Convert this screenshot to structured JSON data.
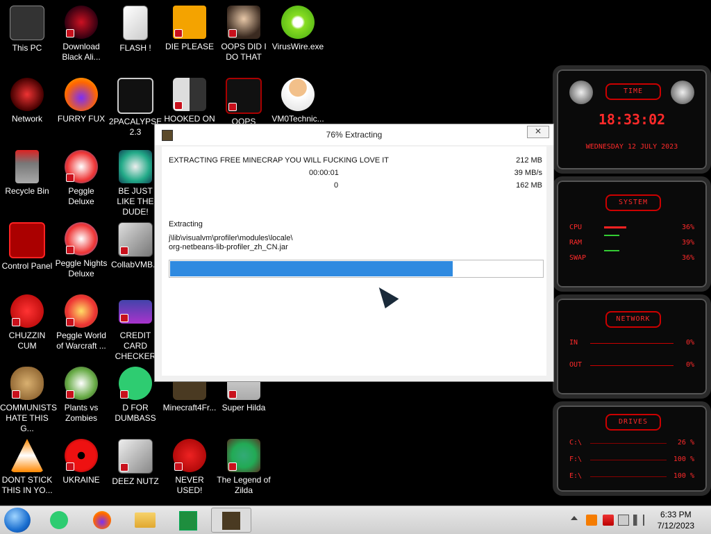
{
  "desktop_icons": [
    {
      "label": "This PC"
    },
    {
      "label": "Download Black Ali..."
    },
    {
      "label": "FLASH !"
    },
    {
      "label": "DIE PLEASE"
    },
    {
      "label": "OOPS DID I DO THAT"
    },
    {
      "label": "VirusWire.exe"
    },
    {
      "label": "Network"
    },
    {
      "label": "FURRY FUX"
    },
    {
      "label": "2PACALYPSE 2.3"
    },
    {
      "label": "HOOKED ON"
    },
    {
      "label": "OOPS"
    },
    {
      "label": "VM0Technic..."
    },
    {
      "label": "Recycle Bin"
    },
    {
      "label": "Peggle Deluxe"
    },
    {
      "label": "BE JUST LIKE THE DUDE!"
    },
    {
      "label": "Control Panel"
    },
    {
      "label": "Peggle Nights Deluxe"
    },
    {
      "label": "CollabVMB..."
    },
    {
      "label": "CHUZZIN CUM"
    },
    {
      "label": "Peggle World of Warcraft ..."
    },
    {
      "label": "CREDIT CARD CHECKER"
    },
    {
      "label": "COMMUNISTS HATE THIS G..."
    },
    {
      "label": "Plants vs Zombies"
    },
    {
      "label": "D FOR DUMBASS"
    },
    {
      "label": "Minecraft4Fr..."
    },
    {
      "label": "Super Hilda"
    },
    {
      "label": "DONT STICK THIS IN YO..."
    },
    {
      "label": "UKRAINE"
    },
    {
      "label": "DEEZ NUTZ"
    },
    {
      "label": "NEVER USED!"
    },
    {
      "label": "The Legend of Zilda"
    }
  ],
  "dialog": {
    "title": "76% Extracting",
    "close_label": "✕",
    "heading": "EXTRACTING FREE MINECRAP YOU WILL FUCKING LOVE IT",
    "size_total": "212 MB",
    "elapsed": "00:00:01",
    "speed": "39 MB/s",
    "remaining": "0",
    "size_processed": "162 MB",
    "status_label": "Extracting",
    "path_line1": "j\\lib\\visualvm\\profiler\\modules\\locale\\",
    "path_line2": "org-netbeans-lib-profiler_zh_CN.jar",
    "progress_percent": 76
  },
  "widget": {
    "time_title": "TIME",
    "time": "18:33:02",
    "date": "WEDNESDAY 12 JULY 2023",
    "system_title": "SYSTEM",
    "cpu_label": "CPU",
    "cpu_value": "36%",
    "ram_label": "RAM",
    "ram_value": "39%",
    "swap_label": "SWAP",
    "swap_value": "36%",
    "network_title": "NETWORK",
    "in_label": "IN",
    "in_value": "0%",
    "out_label": "OUT",
    "out_value": "0%",
    "drives_title": "DRIVES",
    "drive1_label": "C:\\",
    "drive1_value": "26 %",
    "drive2_label": "F:\\",
    "drive2_value": "100 %",
    "drive3_label": "E:\\",
    "drive3_value": "100 %"
  },
  "taskbar": {
    "time": "6:33 PM",
    "date": "7/12/2023"
  },
  "colors": {
    "accent": "#2f8ae0",
    "widget_red": "#ff2a2a"
  }
}
